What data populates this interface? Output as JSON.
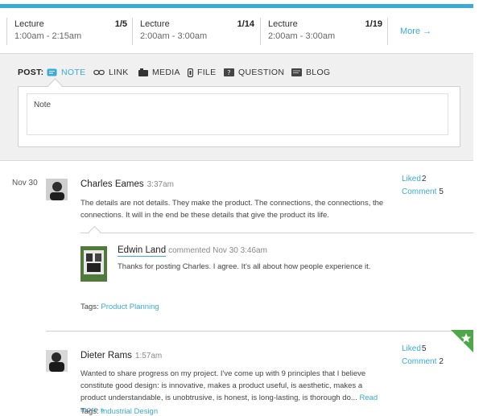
{
  "lectures": [
    {
      "name": "Lecture",
      "time": "1:00am - 2:15am",
      "count": "1/5"
    },
    {
      "name": "Lecture",
      "time": "2:00am - 3:00am",
      "count": "1/14"
    },
    {
      "name": "Lecture",
      "time": "2:00am - 3:00am",
      "count": "1/19"
    }
  ],
  "more_label": "More →",
  "post": {
    "label": "POST:",
    "tabs": [
      {
        "label": "NOTE",
        "icon": "note-icon"
      },
      {
        "label": "LINK",
        "icon": "link-icon"
      },
      {
        "label": "MEDIA",
        "icon": "media-icon"
      },
      {
        "label": "FILE",
        "icon": "file-icon"
      },
      {
        "label": "QUESTION",
        "icon": "question-icon"
      },
      {
        "label": "BLOG",
        "icon": "blog-icon"
      }
    ],
    "note_placeholder": "Note"
  },
  "feed": {
    "date": "Nov 30",
    "posts": [
      {
        "author": "Charles Eames",
        "time": "3:37am",
        "body": "The details are not details. They make the product. The connections, the connections, the connections. It will in the end be these details that give the product its life.",
        "liked_label": "Liked",
        "liked_count": "2",
        "comment_label": "Comment",
        "comment_count": "5",
        "comment": {
          "author": "Edwin Land",
          "meta": "commented Nov 30 3:46am",
          "text": "Thanks for posting Charles. I agree. It's all about how people experience it."
        },
        "tags_label": "Tags:",
        "tag": "Product Planning"
      },
      {
        "author": "Dieter Rams",
        "time": "1:57am",
        "body": "Wanted to share progress on my project. I've come up with 9 principles that I believe constitute good design: is innovative, makes a product useful, is aesthetic, makes a product understandable, is unobtrusive, is honest, is long-lasting, is thorough do...",
        "read_more": "Read more »",
        "liked_label": "Liked",
        "liked_count": "5",
        "comment_label": "Comment",
        "comment_count": "2",
        "tags_label": "Tags:",
        "tag": "Industrial Design"
      }
    ]
  },
  "colors": {
    "accent": "#3aaad6",
    "corner": "#4ea84a"
  }
}
